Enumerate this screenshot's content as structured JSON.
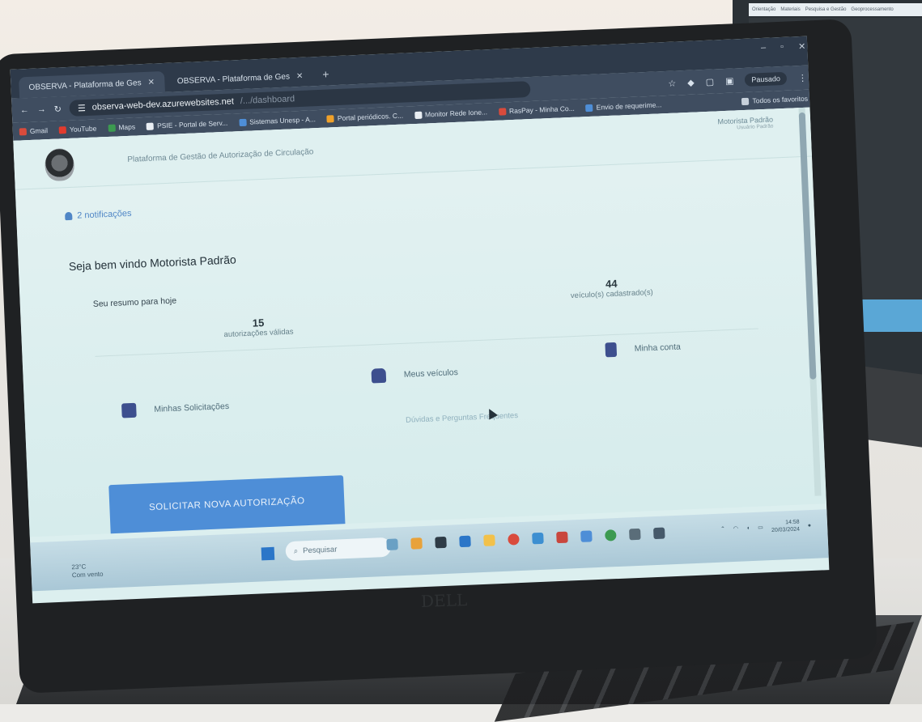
{
  "monitor_bg": {
    "tabs": [
      "Orientação",
      "Materiais",
      "Pesquisa e Gestão",
      "Geoprocessamento"
    ]
  },
  "browser": {
    "tabs": [
      {
        "label": "OBSERVA - Plataforma de Ges",
        "active": true
      },
      {
        "label": "OBSERVA - Plataforma de Ges",
        "active": false
      }
    ],
    "url": "observa-web-dev.azurewebsites.net",
    "url_dim": "/.../dashboard",
    "profile_pill": "Pausado",
    "bookmarks": [
      {
        "label": "Gmail",
        "color": "#d94b3c"
      },
      {
        "label": "YouTube",
        "color": "#e23b2e"
      },
      {
        "label": "Maps",
        "color": "#3c9a50"
      },
      {
        "label": "PSIE - Portal de Serv...",
        "color": "#e9eef3"
      },
      {
        "label": "Sistemas Unesp - A...",
        "color": "#4e8ed7"
      },
      {
        "label": "Portal periódicos. C...",
        "color": "#f0a12a"
      },
      {
        "label": "Monitor Rede Ione...",
        "color": "#e9eef3"
      },
      {
        "label": "RasPay - Minha Co...",
        "color": "#d94b3c"
      },
      {
        "label": "Envio de requerime...",
        "color": "#4e8ed7"
      }
    ],
    "bookmarks_all": "Todos os favoritos"
  },
  "page": {
    "platform_title": "Plataforma de Gestão de Autorização de Circulação",
    "user_name": "Motorista Padrão",
    "user_role": "Usuário Padrão",
    "notifications": "2 notificações",
    "welcome": "Seja bem vindo Motorista Padrão",
    "summary_label": "Seu resumo para hoje",
    "stats": [
      {
        "value": "15",
        "label": "autorizações válidas"
      },
      {
        "value": "44",
        "label": "veículo(s) cadastrado(s)"
      }
    ],
    "cards": [
      {
        "label": "Minhas Solicitações",
        "icon": "document-hand-icon"
      },
      {
        "label": "Meus veículos",
        "icon": "car-icon"
      },
      {
        "label": "Minha conta",
        "icon": "id-card-icon"
      }
    ],
    "faq": "Dúvidas e Perguntas Frequentes",
    "cta": "SOLICITAR NOVA AUTORIZAÇÃO"
  },
  "taskbar": {
    "weather_temp": "23°C",
    "weather_desc": "Com vento",
    "search_placeholder": "Pesquisar",
    "clock_time": "14:58",
    "clock_date": "20/03/2024"
  }
}
